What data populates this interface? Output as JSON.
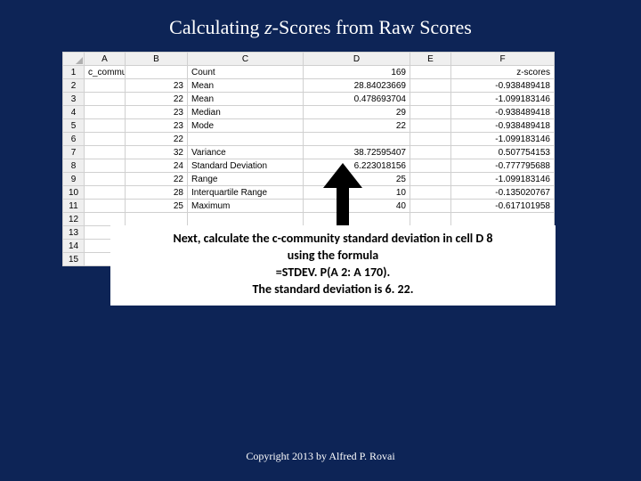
{
  "title_pre": "Calculating ",
  "title_z": "z",
  "title_post": "-Scores from Raw Scores",
  "columns": [
    "A",
    "B",
    "C",
    "D",
    "E",
    "F"
  ],
  "rows": [
    {
      "n": "1",
      "A": "c_community",
      "B": "",
      "C": "Count",
      "D": "169",
      "E": "",
      "F": "z-scores"
    },
    {
      "n": "2",
      "A": "",
      "B": "23",
      "C": "Mean",
      "D": "28.84023669",
      "E": "",
      "F": "-0.938489418"
    },
    {
      "n": "3",
      "A": "",
      "B": "22",
      "C": "Mean",
      "D": "0.478693704",
      "E": "",
      "F": "-1.099183146"
    },
    {
      "n": "4",
      "A": "",
      "B": "23",
      "C": "Median",
      "D": "29",
      "E": "",
      "F": "-0.938489418"
    },
    {
      "n": "5",
      "A": "",
      "B": "23",
      "C": "Mode",
      "D": "22",
      "E": "",
      "F": "-0.938489418"
    },
    {
      "n": "6",
      "A": "",
      "B": "22",
      "C": "",
      "D": "",
      "E": "",
      "F": "-1.099183146"
    },
    {
      "n": "7",
      "A": "",
      "B": "32",
      "C": "Variance",
      "D": "38.72595407",
      "E": "",
      "F": "0.507754153"
    },
    {
      "n": "8",
      "A": "",
      "B": "24",
      "C": "Standard Deviation",
      "D": "6.223018156",
      "E": "",
      "F": "-0.777795688"
    },
    {
      "n": "9",
      "A": "",
      "B": "22",
      "C": "Range",
      "D": "25",
      "E": "",
      "F": "-1.099183146"
    },
    {
      "n": "10",
      "A": "",
      "B": "28",
      "C": "Interquartile Range",
      "D": "10",
      "E": "",
      "F": "-0.135020767"
    },
    {
      "n": "11",
      "A": "",
      "B": "25",
      "C": "Maximum",
      "D": "40",
      "E": "",
      "F": "-0.617101958"
    },
    {
      "n": "12",
      "A": "",
      "B": "",
      "C": "",
      "D": "",
      "E": "",
      "F": ""
    },
    {
      "n": "13",
      "A": "",
      "B": "",
      "C": "",
      "D": "",
      "E": "",
      "F": ""
    },
    {
      "n": "14",
      "A": "",
      "B": "",
      "C": "",
      "D": "",
      "E": "",
      "F": ""
    },
    {
      "n": "15",
      "A": "",
      "B": "",
      "C": "",
      "D": "",
      "E": "",
      "F": ""
    }
  ],
  "caption_l1": "Next, calculate the c-community standard deviation in cell D 8",
  "caption_l2": "using the formula",
  "caption_l3": "=STDEV. P(A 2: A 170).",
  "caption_l4": "The standard deviation is 6. 22.",
  "copyright": "Copyright 2013 by Alfred P. Rovai"
}
